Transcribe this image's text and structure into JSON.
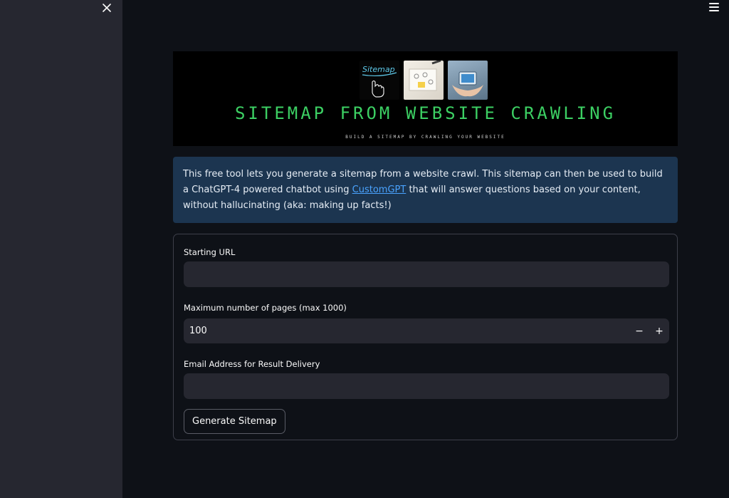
{
  "sidebar": {
    "close_icon": "close-icon"
  },
  "header": {
    "menu_icon": "hamburger-menu-icon"
  },
  "banner": {
    "image_caption": "Sitemap",
    "title": "SITEMAP FROM WEBSITE CRAWLING",
    "subtitle": "BUILD A SITEMAP BY CRAWLING YOUR WEBSITE"
  },
  "info": {
    "text_before": "This free tool lets you generate a sitemap from a website crawl. This sitemap can then be used to build a ChatGPT-4 powered chatbot using ",
    "link_text": "CustomGPT",
    "text_after": " that will answer questions based on your content, without hallucinating (aka: making up facts!)"
  },
  "form": {
    "url_label": "Starting URL",
    "url_value": "",
    "pages_label": "Maximum number of pages (max 1000)",
    "pages_value": "100",
    "minus_label": "−",
    "plus_label": "+",
    "email_label": "Email Address for Result Delivery",
    "email_value": "",
    "submit_label": "Generate Sitemap"
  },
  "colors": {
    "background": "#0e1117",
    "sidebar": "#262730",
    "accent_green": "#3ccf63",
    "info_bg": "#1c3550",
    "link": "#4aa3ff"
  }
}
